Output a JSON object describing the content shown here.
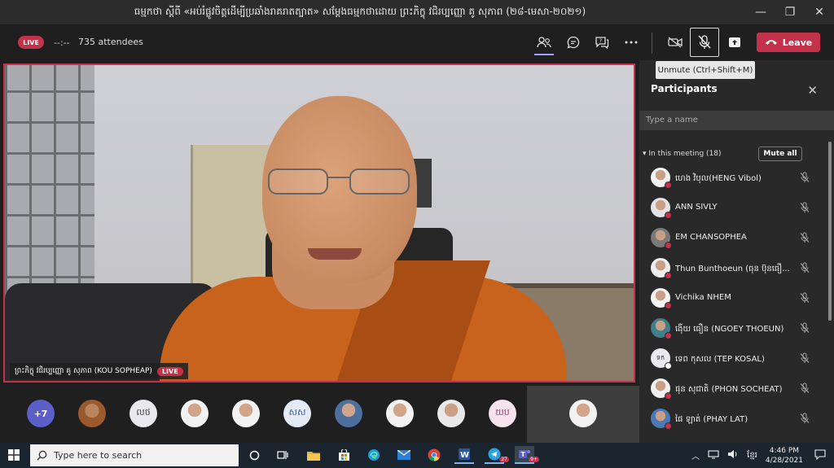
{
  "window": {
    "title": "ធម្មកថា ស្ដីពី «អប់រំផ្លូវចិត្តដើម្បីប្រឆាំងរាគរាតត្បាត» សម្ដែងធម្មកថាដោយ ព្រះភិក្ខុ វជិរប្បញ្ញោ គូ សុភាព (២៨-មេសា-២០២១)",
    "minimize": "—",
    "restore": "❐",
    "close": "✕"
  },
  "meeting": {
    "live_label": "LIVE",
    "timer": "--:--",
    "attendees": "735 attendees",
    "leave_label": "Leave",
    "tooltip": "Unmute (Ctrl+Shift+M)"
  },
  "video": {
    "presenter_name": "ព្រះភិក្ខុ វជិរប្បញ្ញោ គូ សុភាព (KOU SOPHEAP)",
    "live_label": "LIVE"
  },
  "gallery": {
    "overflow_count": "+7",
    "initials": [
      "លថ",
      "សស",
      "យប"
    ]
  },
  "participants": {
    "title": "Participants",
    "close": "✕",
    "search_placeholder": "Type a name",
    "section_label": "In this meeting (18)",
    "mute_all_label": "Mute all",
    "list": [
      {
        "name": "ហេង វិបុល(HENG Vibol)"
      },
      {
        "name": "ANN SIVLY"
      },
      {
        "name": "EM CHANSOPHEA"
      },
      {
        "name": "Thun Bunthoeun (ធុន ប៊ុនធឿ..."
      },
      {
        "name": "Vichika NHEM"
      },
      {
        "name": "ង៉ើយ ធឿន (NGOEY THOEUN)"
      },
      {
        "name": "ទេព កុសល (TEP KOSAL)",
        "initials": "ទក"
      },
      {
        "name": "ផុន សុជាតិ (PHON SOCHEAT)"
      },
      {
        "name": "ផៃ ឡាត់ (PHAY LAT)"
      }
    ]
  },
  "taskbar": {
    "search_placeholder": "Type here to search",
    "language": "ខ្មែរ",
    "time": "4:46 PM",
    "date": "4/28/2021",
    "telegram_badge": "27",
    "teams_badge": "9+"
  },
  "colors": {
    "accent_red": "#c4314b",
    "panel_bg": "#292929",
    "app_bg": "#1f1f1f"
  }
}
